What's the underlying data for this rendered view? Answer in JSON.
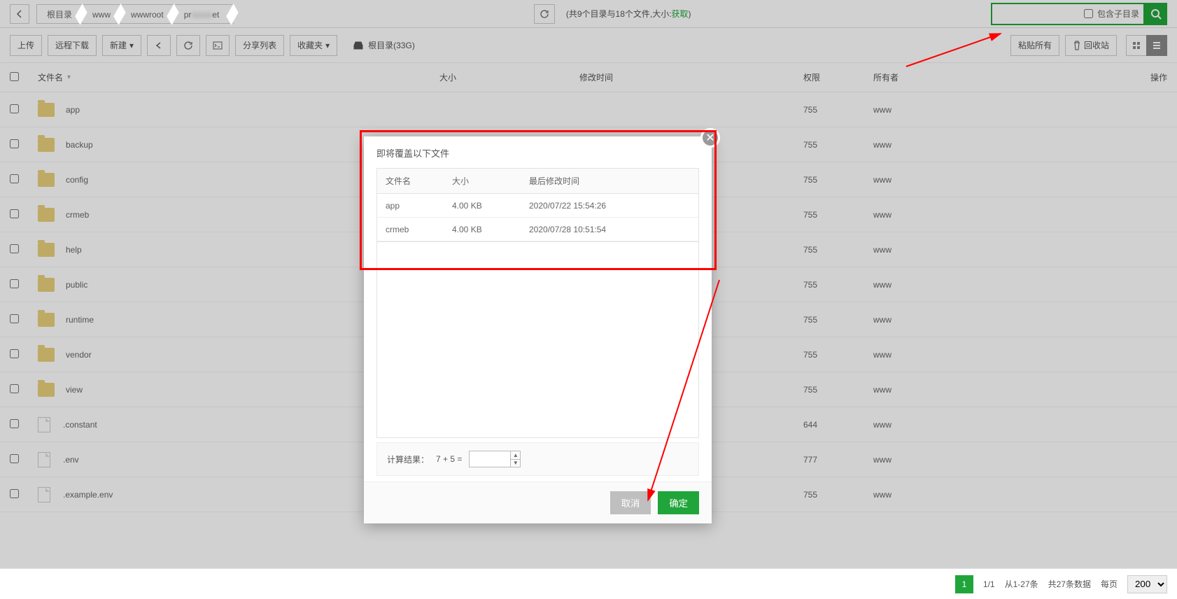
{
  "breadcrumb": [
    "根目录",
    "www",
    "wwwroot",
    "pr██████et"
  ],
  "status": {
    "prefix": "(共9个目录与18个文件,大小:",
    "get": "获取",
    "suffix": ")"
  },
  "search": {
    "sublabel": "包含子目录"
  },
  "toolbar": {
    "upload": "上传",
    "remote": "远程下载",
    "new": "新建",
    "sharelist": "分享列表",
    "fav": "收藏夹",
    "rootlabel": "根目录(33G)",
    "pasteall": "粘贴所有",
    "recycle": "回收站"
  },
  "columns": {
    "name": "文件名",
    "size": "大小",
    "mtime": "修改时间",
    "perm": "权限",
    "owner": "所有者",
    "act": "操作"
  },
  "rows": [
    {
      "name": "app",
      "type": "folder",
      "perm": "755",
      "owner": "www"
    },
    {
      "name": "backup",
      "type": "folder",
      "perm": "755",
      "owner": "www"
    },
    {
      "name": "config",
      "type": "folder",
      "perm": "755",
      "owner": "www"
    },
    {
      "name": "crmeb",
      "type": "folder",
      "perm": "755",
      "owner": "www"
    },
    {
      "name": "help",
      "type": "folder",
      "perm": "755",
      "owner": "www"
    },
    {
      "name": "public",
      "type": "folder",
      "perm": "755",
      "owner": "www"
    },
    {
      "name": "runtime",
      "type": "folder",
      "perm": "755",
      "owner": "www"
    },
    {
      "name": "vendor",
      "type": "folder",
      "perm": "755",
      "owner": "www"
    },
    {
      "name": "view",
      "type": "folder",
      "perm": "755",
      "owner": "www"
    },
    {
      "name": ".constant",
      "type": "file",
      "perm": "644",
      "owner": "www"
    },
    {
      "name": ".env",
      "type": "file",
      "perm": "777",
      "owner": "www"
    },
    {
      "name": ".example.env",
      "type": "file",
      "perm": "755",
      "owner": "www"
    }
  ],
  "dialog": {
    "title": "即将覆盖以下文件",
    "cols": {
      "name": "文件名",
      "size": "大小",
      "mtime": "最后修改时间"
    },
    "rows": [
      {
        "name": "app",
        "size": "4.00 KB",
        "mtime": "2020/07/22 15:54:26"
      },
      {
        "name": "crmeb",
        "size": "4.00 KB",
        "mtime": "2020/07/28 10:51:54"
      }
    ],
    "calc_label": "计算结果：",
    "calc_expr": "7 + 5  =",
    "cancel": "取消",
    "ok": "确定"
  },
  "footer": {
    "page": "1",
    "pages": "1/1",
    "range": "从1-27条",
    "total": "共27条数据",
    "perpage_label": "每页",
    "perpage_val": "200"
  }
}
